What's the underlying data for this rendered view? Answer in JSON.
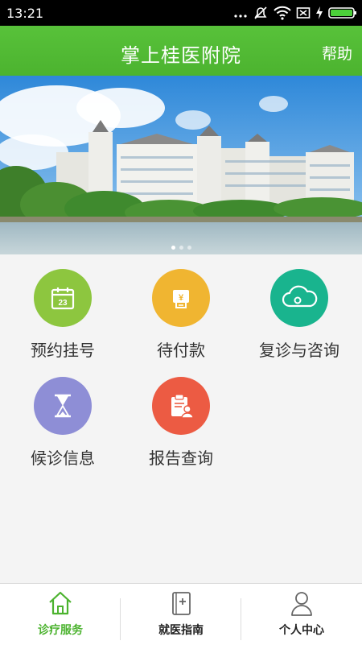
{
  "status_bar": {
    "time": "13:21"
  },
  "header": {
    "title": "掌上桂医附院",
    "help_label": "帮助"
  },
  "banner": {
    "slide_count": 3,
    "active_slide": 1
  },
  "menu": {
    "items": [
      {
        "label": "预约挂号",
        "color": "#8dc63f",
        "icon": "calendar-icon",
        "calendar_day": "23"
      },
      {
        "label": "待付款",
        "color": "#f0b531",
        "icon": "payment-icon"
      },
      {
        "label": "复诊与咨询",
        "color": "#19b48e",
        "icon": "cloud-icon"
      },
      {
        "label": "候诊信息",
        "color": "#8e8ed6",
        "icon": "hourglass-icon"
      },
      {
        "label": "报告查询",
        "color": "#ec5b43",
        "icon": "report-icon"
      }
    ]
  },
  "tab_bar": {
    "tabs": [
      {
        "label": "诊疗服务",
        "icon": "home-icon",
        "active": true
      },
      {
        "label": "就医指南",
        "icon": "guide-book-icon",
        "active": false
      },
      {
        "label": "个人中心",
        "icon": "person-icon",
        "active": false
      }
    ]
  }
}
